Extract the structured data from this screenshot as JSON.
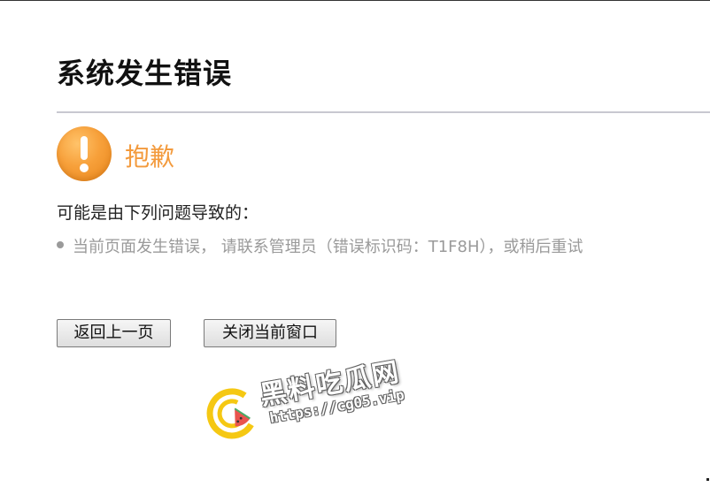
{
  "page": {
    "title": "系统发生错误"
  },
  "alert": {
    "icon": "exclamation-circle-icon",
    "heading": "抱歉",
    "color": "#f39a3c"
  },
  "causes": {
    "heading": "可能是由下列问题导致的：",
    "items": [
      "当前页面发生错误， 请联系管理员（错误标识码：T1F8H），或稍后重试"
    ]
  },
  "actions": {
    "back_label": "返回上一页",
    "close_label": "关闭当前窗口"
  },
  "watermark": {
    "name": "黑料吃瓜网",
    "url": "https://cg05.vip",
    "icon": "watermelon-logo-icon",
    "colors": {
      "ring": "#f5c400",
      "melon": "#e8463f"
    }
  }
}
